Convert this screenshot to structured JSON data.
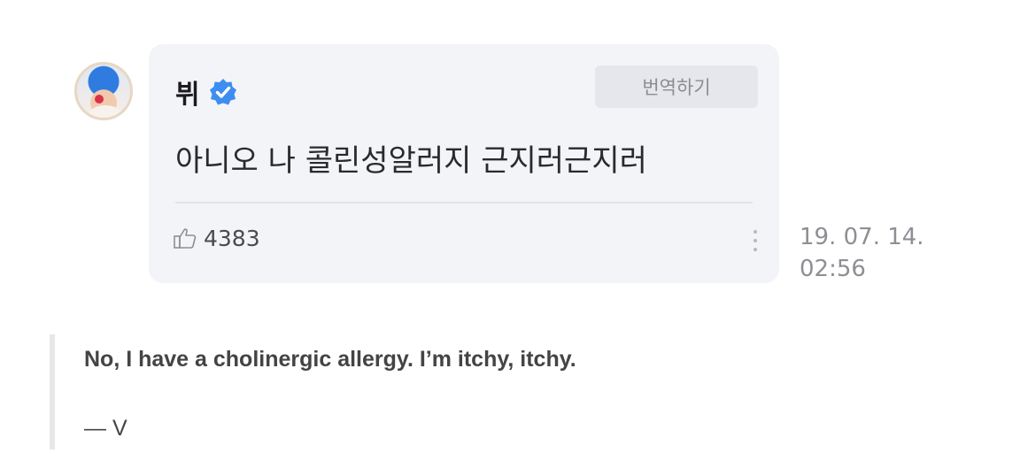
{
  "post": {
    "author_name": "뷔",
    "verified_icon": "verified-badge-icon",
    "translate_label": "번역하기",
    "message": "아니오 나 콜린성알러지 근지러근지러",
    "like_icon": "thumbs-up-icon",
    "like_count": "4383",
    "more_icon": "more-vertical-icon",
    "date": "19. 07. 14.",
    "time": "02:56"
  },
  "quote": {
    "translation": "No, I have a cholinergic allergy. I’m itchy, itchy.",
    "attribution": "— V"
  },
  "colors": {
    "card_background": "#f3f4f8",
    "verified_blue": "#3d8ef0",
    "translate_button": "#e6e7ec"
  }
}
